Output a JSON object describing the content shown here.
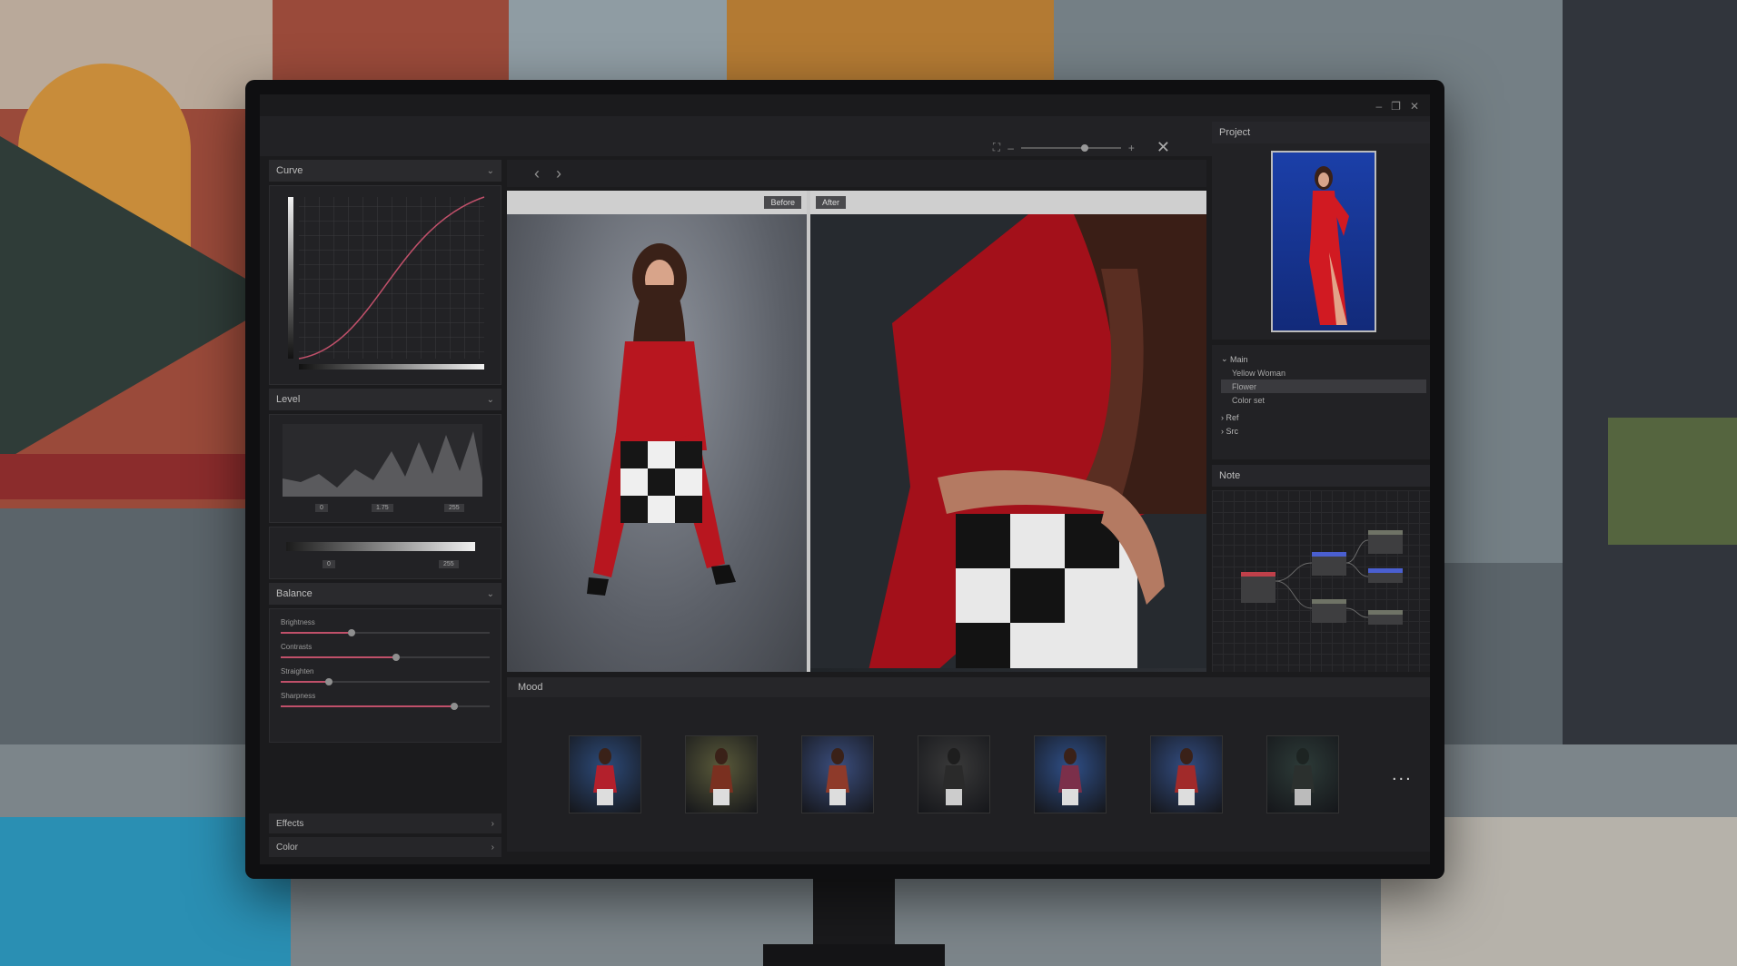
{
  "window": {
    "controls": [
      "–",
      "❐",
      "✕"
    ]
  },
  "left_panel": {
    "curve": {
      "title": "Curve"
    },
    "level": {
      "title": "Level",
      "values": [
        "0",
        "1.75",
        "255"
      ],
      "output_values": [
        "0",
        "255"
      ]
    },
    "balance": {
      "title": "Balance",
      "sliders": [
        {
          "label": "Brightness",
          "value": 0.34
        },
        {
          "label": "Contrasts",
          "value": 0.55
        },
        {
          "label": "Straighten",
          "value": 0.23
        },
        {
          "label": "Sharpness",
          "value": 0.83
        }
      ]
    },
    "effects": {
      "title": "Effects"
    },
    "color": {
      "title": "Color"
    }
  },
  "viewer": {
    "nav": {
      "prev": "‹",
      "next": "›"
    },
    "zoom": {
      "minus": "–",
      "plus": "+",
      "level": 0.6,
      "close": "✕"
    },
    "before_label": "Before",
    "after_label": "After"
  },
  "mood": {
    "title": "Mood",
    "thumbnails": [
      {
        "bg": "#2d4b7a",
        "dress": "#b3202c"
      },
      {
        "bg": "#5a5a3a",
        "dress": "#7a3020"
      },
      {
        "bg": "#3b4e7e",
        "dress": "#8e3a2a"
      },
      {
        "bg": "#3a3a3a",
        "dress": "#2a2a2a"
      },
      {
        "bg": "#2f4f88",
        "dress": "#7b2f4a"
      },
      {
        "bg": "#324c80",
        "dress": "#a12a2a"
      },
      {
        "bg": "#2d3b38",
        "dress": "#2b302e"
      }
    ],
    "more": "..."
  },
  "right_panel": {
    "project": {
      "title": "Project"
    },
    "tree": {
      "main": "Main",
      "main_children": [
        "Yellow Woman",
        "Flower",
        "Color set"
      ],
      "selected_index": 1,
      "ref": "Ref",
      "src": "Src"
    },
    "note": {
      "title": "Note"
    }
  },
  "colors": {
    "accent": "#c0506a",
    "node_red": "#c0404a",
    "node_blue": "#4a5fd0",
    "node_gray": "#6f7366",
    "dress_red": "#b8161f"
  }
}
